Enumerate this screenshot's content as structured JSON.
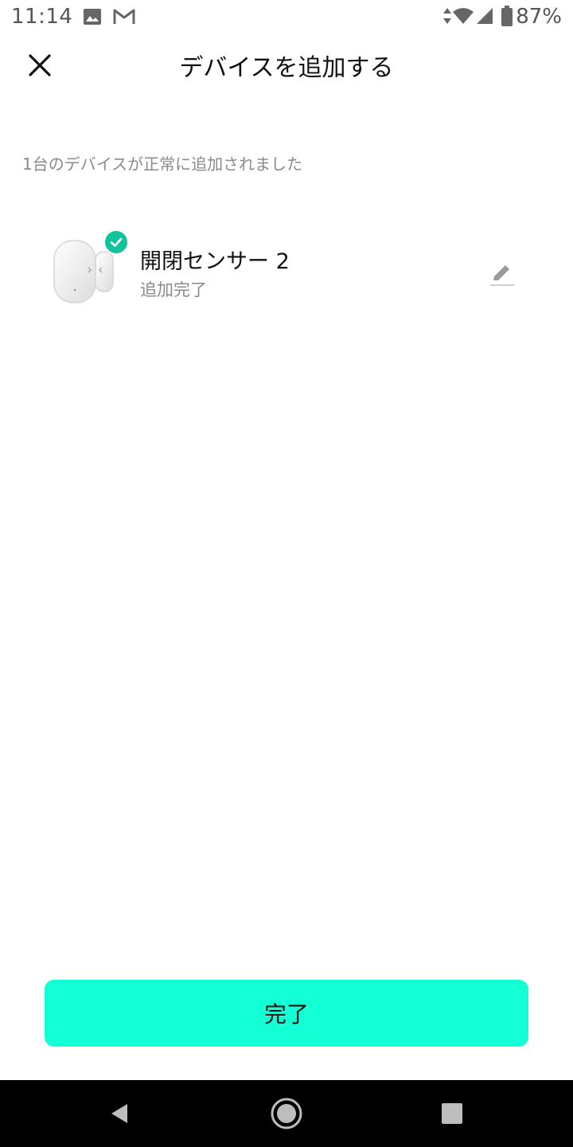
{
  "status_bar": {
    "time": "11:14",
    "battery": "87%",
    "icons": [
      "image-icon",
      "gmail-icon",
      "data-arrows-icon",
      "wifi-icon",
      "signal-icon",
      "battery-icon"
    ]
  },
  "header": {
    "title": "デバイスを追加する",
    "close_icon": "close-icon"
  },
  "result": {
    "message": "1台のデバイスが正常に追加されました"
  },
  "device": {
    "name": "開閉センサー 2",
    "status": "追加完了",
    "badge_icon": "check-icon",
    "edit_icon": "pencil-icon"
  },
  "footer": {
    "done_label": "完了"
  },
  "navigation": {
    "back_icon": "back-triangle-icon",
    "home_icon": "home-circle-icon",
    "recents_icon": "recents-square-icon"
  },
  "colors": {
    "accent": "#13ffd5",
    "success": "#12c49b",
    "muted_text": "#8a8a8a"
  }
}
